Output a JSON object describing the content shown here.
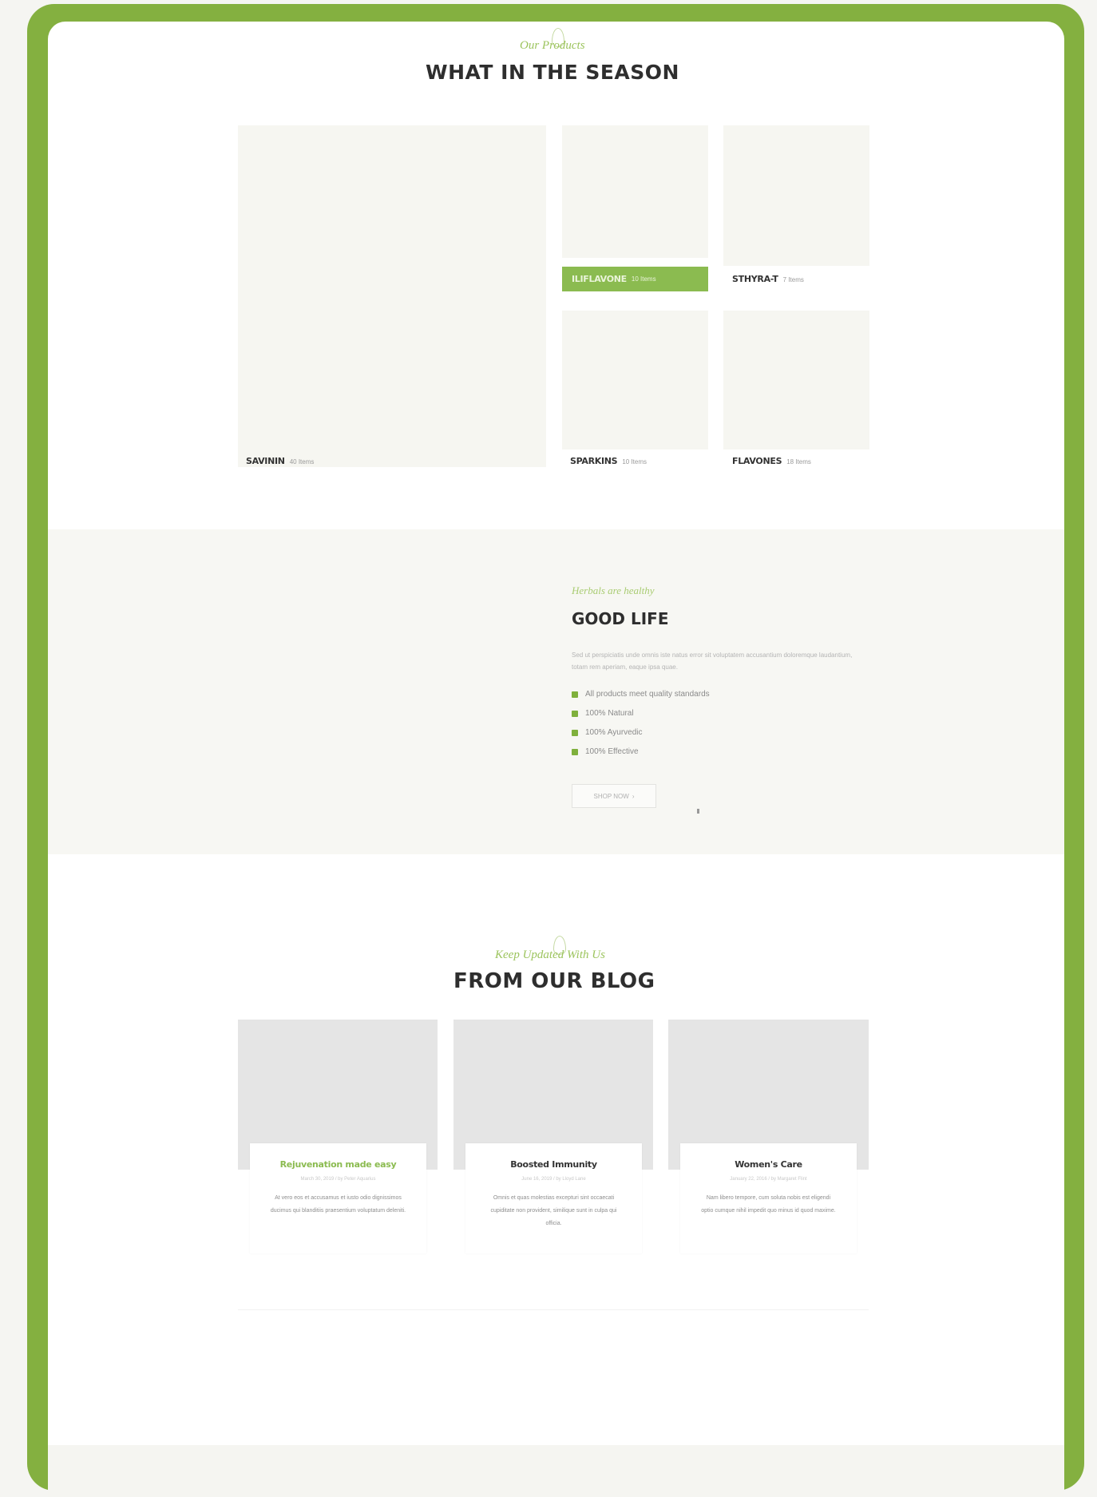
{
  "season": {
    "eyebrow": "Our Products",
    "title": "WHAT IN THE SEASON",
    "categories": [
      {
        "name": "SAVININ",
        "count": "40 Items"
      },
      {
        "name": "ILIFLAVONE",
        "count": "10 Items"
      },
      {
        "name": "STHYRA-T",
        "count": "7 Items"
      },
      {
        "name": "SPARKINS",
        "count": "10 Items"
      },
      {
        "name": "FLAVONES",
        "count": "18 Items"
      }
    ]
  },
  "good_life": {
    "eyebrow": "Herbals are healthy",
    "title": "GOOD LIFE",
    "description": "Sed ut perspiciatis unde omnis iste natus error sit voluptatem accusantium doloremque laudantium, totam rem aperiam, eaque ipsa quae.",
    "features": [
      "All products meet quality standards",
      "100% Natural",
      "100% Ayurvedic",
      "100% Effective"
    ],
    "button_label": "SHOP NOW",
    "button_icon": "arrow-right-icon"
  },
  "blog": {
    "eyebrow": "Keep Updated With Us",
    "title": "FROM OUR BLOG",
    "posts": [
      {
        "title": "Rejuvenation made easy",
        "meta": "March 30, 2019 / by Peter Aquarius",
        "excerpt": "At vero eos et accusamus et iusto odio dignissimos ducimus qui blanditiis praesentium voluptatum deleniti."
      },
      {
        "title": "Boosted Immunity",
        "meta": "June 16, 2019 / by Lloyd Lane",
        "excerpt": "Omnis et quas molestias excepturi sint occaecati cupiditate non provident, similique sunt in culpa qui officia."
      },
      {
        "title": "Women's Care",
        "meta": "January 22, 2016 / by Margaret Flint",
        "excerpt": "Nam libero tempore, cum soluta nobis est eligendi optio cumque nihil impedit quo minus id quod maxime."
      }
    ]
  },
  "colors": {
    "frame": "#84b040",
    "accent": "#8bbb50",
    "tile": "#f6f6f1"
  }
}
